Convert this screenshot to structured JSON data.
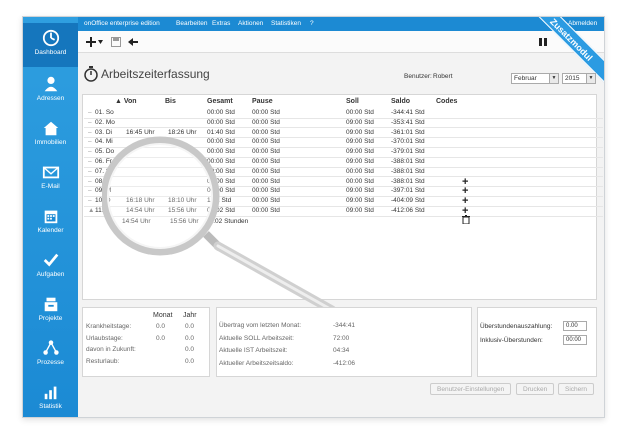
{
  "topbar": {
    "edition": "onOffice enterprise edition",
    "menu": [
      "Bearbeiten",
      "Extras",
      "Aktionen",
      "Statistiken",
      "?"
    ],
    "logout": "Abmelden"
  },
  "ribbon": "Zusatzmodul",
  "nav": [
    {
      "label": "Dashboard",
      "icon": "dashboard-icon"
    },
    {
      "label": "Adressen",
      "icon": "person-icon"
    },
    {
      "label": "Immobilien",
      "icon": "house-icon"
    },
    {
      "label": "E-Mail",
      "icon": "envelope-icon"
    },
    {
      "label": "Kalender",
      "icon": "calendar-icon"
    },
    {
      "label": "Aufgaben",
      "icon": "checkmark-icon"
    },
    {
      "label": "Projekte",
      "icon": "projects-icon"
    },
    {
      "label": "Prozesse",
      "icon": "process-icon"
    },
    {
      "label": "Statistik",
      "icon": "chart-icon"
    }
  ],
  "page": {
    "title": "Arbeitszeiterfassung",
    "user_label": "Benutzer:",
    "user": "Robert",
    "month": "Februar",
    "year": "2015"
  },
  "table": {
    "headers": {
      "von": "Von",
      "bis": "Bis",
      "gesamt": "Gesamt",
      "pause": "Pause",
      "soll": "Soll",
      "saldo": "Saldo",
      "codes": "Codes"
    },
    "rows": [
      {
        "day": "01. So",
        "von": "",
        "bis": "",
        "gesamt": "00:00 Std",
        "pause": "00:00 Std",
        "soll": "00:00 Std",
        "saldo": "-344:41 Std",
        "codes": ""
      },
      {
        "day": "02. Mo",
        "von": "",
        "bis": "",
        "gesamt": "00:00 Std",
        "pause": "00:00 Std",
        "soll": "09:00 Std",
        "saldo": "-353:41 Std",
        "codes": ""
      },
      {
        "day": "03. Di",
        "von": "16:45 Uhr",
        "bis": "18:26 Uhr",
        "gesamt": "01:40 Std",
        "pause": "00:00 Std",
        "soll": "09:00 Std",
        "saldo": "-361:01 Std",
        "codes": ""
      },
      {
        "day": "04. Mi",
        "von": "",
        "bis": "",
        "gesamt": "00:00 Std",
        "pause": "00:00 Std",
        "soll": "09:00 Std",
        "saldo": "-370:01 Std",
        "codes": ""
      },
      {
        "day": "05. Do",
        "von": "",
        "bis": "",
        "gesamt": "00:00 Std",
        "pause": "00:00 Std",
        "soll": "09:00 Std",
        "saldo": "-379:01 Std",
        "codes": ""
      },
      {
        "day": "06. Fr",
        "von": "",
        "bis": "",
        "gesamt": "00:00 Std",
        "pause": "00:00 Std",
        "soll": "09:00 Std",
        "saldo": "-388:01 Std",
        "codes": ""
      },
      {
        "day": "07. Sa",
        "von": "",
        "bis": "",
        "gesamt": "00:00 Std",
        "pause": "00:00 Std",
        "soll": "00:00 Std",
        "saldo": "-388:01 Std",
        "codes": ""
      },
      {
        "day": "08. S",
        "von": "",
        "bis": "",
        "gesamt": "00:00 Std",
        "pause": "00:00 Std",
        "soll": "00:00 Std",
        "saldo": "-388:01 Std",
        "codes": "+"
      },
      {
        "day": "09. M",
        "von": "",
        "bis": "",
        "gesamt": "00:00 Std",
        "pause": "00:00 Std",
        "soll": "09:00 Std",
        "saldo": "-397:01 Std",
        "codes": "+"
      },
      {
        "day": "10. D",
        "von": "16:18 Uhr",
        "bis": "18:10 Uhr",
        "gesamt": "1:51 Std",
        "pause": "00:00 Std",
        "soll": "09:00 Std",
        "saldo": "-404:09 Std",
        "codes": "+"
      },
      {
        "day": "11. M",
        "von": "14:54 Uhr",
        "bis": "15:56 Uhr",
        "gesamt": "01:02 Std",
        "pause": "00:00 Std",
        "soll": "09:00 Std",
        "saldo": "-412:06 Std",
        "codes": "+"
      }
    ],
    "subrow": {
      "von": "14:54 Uhr",
      "bis": "15:56 Uhr",
      "gesamt": "01:02 Stunden"
    }
  },
  "stats": {
    "headers": {
      "monat": "Monat",
      "jahr": "Jahr"
    },
    "rows": [
      {
        "label": "Krankheitstage:",
        "monat": "0.0",
        "jahr": "0.0"
      },
      {
        "label": "Urlaubstage:",
        "monat": "0.0",
        "jahr": "0.0"
      },
      {
        "label": "davon in Zukunft:",
        "monat": "",
        "jahr": "0.0"
      },
      {
        "label": "Resturlaub:",
        "monat": "",
        "jahr": "0.0"
      }
    ]
  },
  "summary": [
    {
      "label": "Übertrag vom letzten Monat:",
      "value": "-344:41"
    },
    {
      "label": "Aktuelle SOLL Arbeitszeit:",
      "value": "72:00"
    },
    {
      "label": "Aktuelle IST Arbeitszeit:",
      "value": "04:34"
    },
    {
      "label": "Aktueller Arbeitszeitsaldo:",
      "value": "-412:06"
    }
  ],
  "overtime": [
    {
      "label": "Überstundenauszahlung:",
      "value": "0.00"
    },
    {
      "label": "Inklusiv-Überstunden:",
      "value": "00:00"
    }
  ],
  "buttons": {
    "user_settings": "Benutzer-Einstellungen",
    "print": "Drucken",
    "save": "Sichern"
  }
}
